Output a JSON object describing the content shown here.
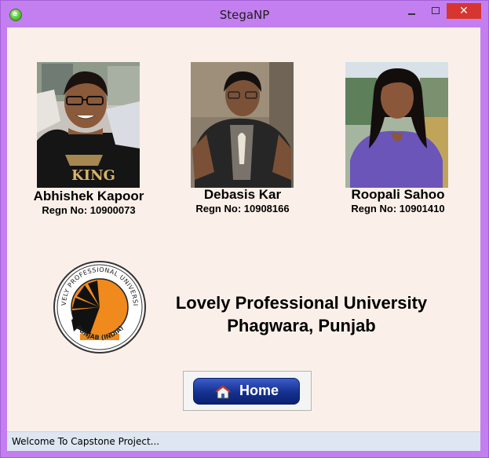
{
  "window": {
    "title": "StegaNP"
  },
  "people": [
    {
      "name": "Abhishek Kapoor",
      "regn": "Regn No: 10900073",
      "shirt_color": "#181818",
      "shirt_text": "KING"
    },
    {
      "name": "Debasis Kar",
      "regn": "Regn No: 10908166",
      "shirt_color": "#2a2a2a"
    },
    {
      "name": "Roopali Sahoo",
      "regn": "Regn No: 10901410",
      "shirt_color": "#6b55b8"
    }
  ],
  "university": {
    "line1": "Lovely Professional University",
    "line2": "Phagwara, Punjab",
    "logo_top_text": "LOVELY PROFESSIONAL UNIVERSITY",
    "logo_bottom_text": "PUNJAB (INDIA)"
  },
  "home_button": {
    "label": "Home"
  },
  "status": {
    "text": "Welcome To Capstone Project..."
  },
  "colors": {
    "window_frame": "#c37ff0",
    "client_bg": "#fbf0e9",
    "close_button": "#d7352f",
    "home_button": "#14318f",
    "statusbar": "#dde6f1",
    "logo_orange": "#f08a1c"
  }
}
